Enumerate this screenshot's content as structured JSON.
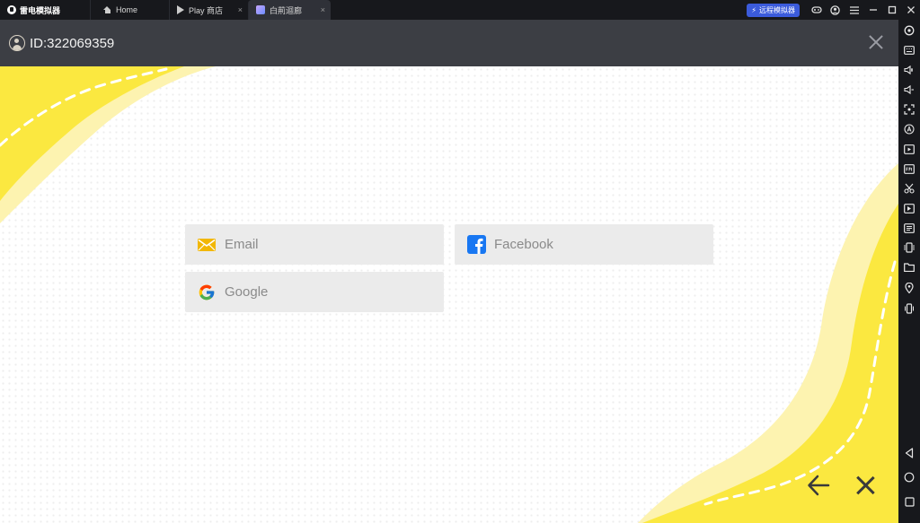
{
  "topbar": {
    "app_name": "雷电模拟器",
    "tabs": [
      {
        "label": "Home"
      },
      {
        "label": "Play 商店",
        "close": "×"
      },
      {
        "label": "白荊迴廊",
        "close": "×"
      }
    ],
    "remote_label": "远程模拟器"
  },
  "header": {
    "user_id": "ID:322069359"
  },
  "login": {
    "email_label": "Email",
    "facebook_label": "Facebook",
    "google_label": "Google"
  },
  "colors": {
    "accent_yellow": "#fbe840",
    "header_bg": "#3c3e44",
    "button_bg": "#ebebeb",
    "facebook_blue": "#1877f2",
    "remote_blue": "#3b5bdb"
  },
  "icons": {
    "topbar": [
      "gamepad-icon",
      "user-circle-icon",
      "menu-icon",
      "minimize-icon",
      "maximize-icon",
      "close-icon"
    ],
    "sidebar": [
      "settings-icon",
      "keyboard-icon",
      "volume-up-icon",
      "volume-down-icon",
      "screenshot-icon",
      "auto-icon",
      "record-icon",
      "fps-icon",
      "scissors-icon",
      "video-icon",
      "list-icon",
      "rotate-icon",
      "folder-icon",
      "location-icon",
      "shake-icon",
      "back-icon",
      "home-icon",
      "recents-icon"
    ]
  }
}
